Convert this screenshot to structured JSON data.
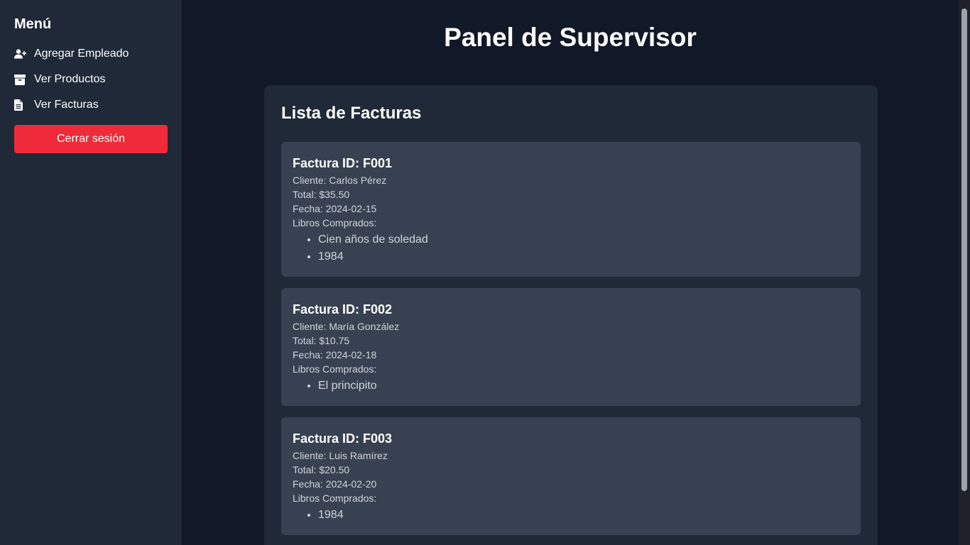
{
  "sidebar": {
    "title": "Menú",
    "items": [
      {
        "label": "Agregar Empleado",
        "icon": "user-plus-icon"
      },
      {
        "label": "Ver Productos",
        "icon": "box-icon"
      },
      {
        "label": "Ver Facturas",
        "icon": "file-invoice-icon"
      }
    ],
    "logout_label": "Cerrar sesión"
  },
  "main": {
    "title": "Panel de Supervisor",
    "panel_title": "Lista de Facturas",
    "invoices": [
      {
        "title": "Factura ID: F001",
        "client": "Cliente: Carlos Pérez",
        "total": "Total: $35.50",
        "date": "Fecha: 2024-02-15",
        "books_label": "Libros Comprados:",
        "books": [
          "Cien años de soledad",
          "1984"
        ]
      },
      {
        "title": "Factura ID: F002",
        "client": "Cliente: María González",
        "total": "Total: $10.75",
        "date": "Fecha: 2024-02-18",
        "books_label": "Libros Comprados:",
        "books": [
          "El principito"
        ]
      },
      {
        "title": "Factura ID: F003",
        "client": "Cliente: Luis Ramírez",
        "total": "Total: $20.50",
        "date": "Fecha: 2024-02-20",
        "books_label": "Libros Comprados:",
        "books": [
          "1984"
        ]
      }
    ]
  },
  "colors": {
    "background": "#111827",
    "sidebar": "#1f2937",
    "card": "#374151",
    "logout": "#ef2b3a"
  }
}
